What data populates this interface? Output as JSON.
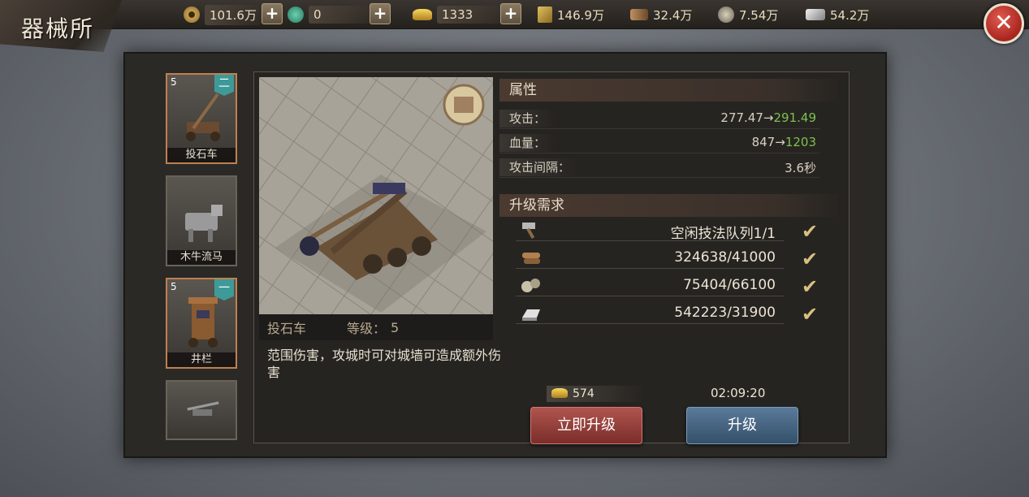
{
  "page": {
    "title": "器械所"
  },
  "resources": [
    {
      "name": "copper",
      "icon": "coin-icon",
      "value": "101.6万",
      "color": "#c8a050"
    },
    {
      "name": "jade",
      "icon": "jade-icon",
      "value": "0",
      "color": "#3aa080"
    },
    {
      "name": "gold",
      "icon": "gold-ingot-icon",
      "value": "1333",
      "color": "#e0b030"
    },
    {
      "name": "grain",
      "icon": "grain-icon",
      "value": "146.9万",
      "color": "#c8a040"
    },
    {
      "name": "wood",
      "icon": "wood-icon",
      "value": "32.4万",
      "color": "#a07850"
    },
    {
      "name": "stone",
      "icon": "stone-icon",
      "value": "7.54万",
      "color": "#b0a890"
    },
    {
      "name": "iron",
      "icon": "iron-icon",
      "value": "54.2万",
      "color": "#c0c0c0"
    }
  ],
  "plus_label": "+",
  "close_label": "✕",
  "sidebar": {
    "items": [
      {
        "level": "5",
        "tier": "二",
        "name": "投石车",
        "active": true
      },
      {
        "level": "",
        "tier": "",
        "name": "木牛流马",
        "active": false
      },
      {
        "level": "5",
        "tier": "一",
        "name": "井栏",
        "active": true
      },
      {
        "level": "",
        "tier": "",
        "name": "",
        "active": false
      }
    ]
  },
  "detail": {
    "name": "投石车",
    "level_label": "等级：",
    "level_value": "5",
    "description": "范围伤害，攻城时可对城墙可造成额外伤害"
  },
  "attributes": {
    "header": "属性",
    "rows": [
      {
        "key": "攻击：",
        "old": "277.47",
        "arrow": "→",
        "new": "291.49"
      },
      {
        "key": "血量：",
        "old": "847",
        "arrow": "→",
        "new": "1203"
      },
      {
        "key": "攻击间隔：",
        "old": "3.6秒",
        "arrow": "",
        "new": ""
      }
    ]
  },
  "requirements": {
    "header": "升级需求",
    "rows": [
      {
        "icon": "hammer-icon",
        "value": "空闲技法队列1/1"
      },
      {
        "icon": "wood-icon",
        "value": "324638/41000"
      },
      {
        "icon": "stone-icon",
        "value": "75404/66100"
      },
      {
        "icon": "iron-icon",
        "value": "542223/31900"
      }
    ],
    "check_glyph": "✔"
  },
  "upgrade": {
    "gold_cost": "574",
    "timer": "02:09:20",
    "instant_label": "立即升级",
    "upgrade_label": "升级"
  }
}
